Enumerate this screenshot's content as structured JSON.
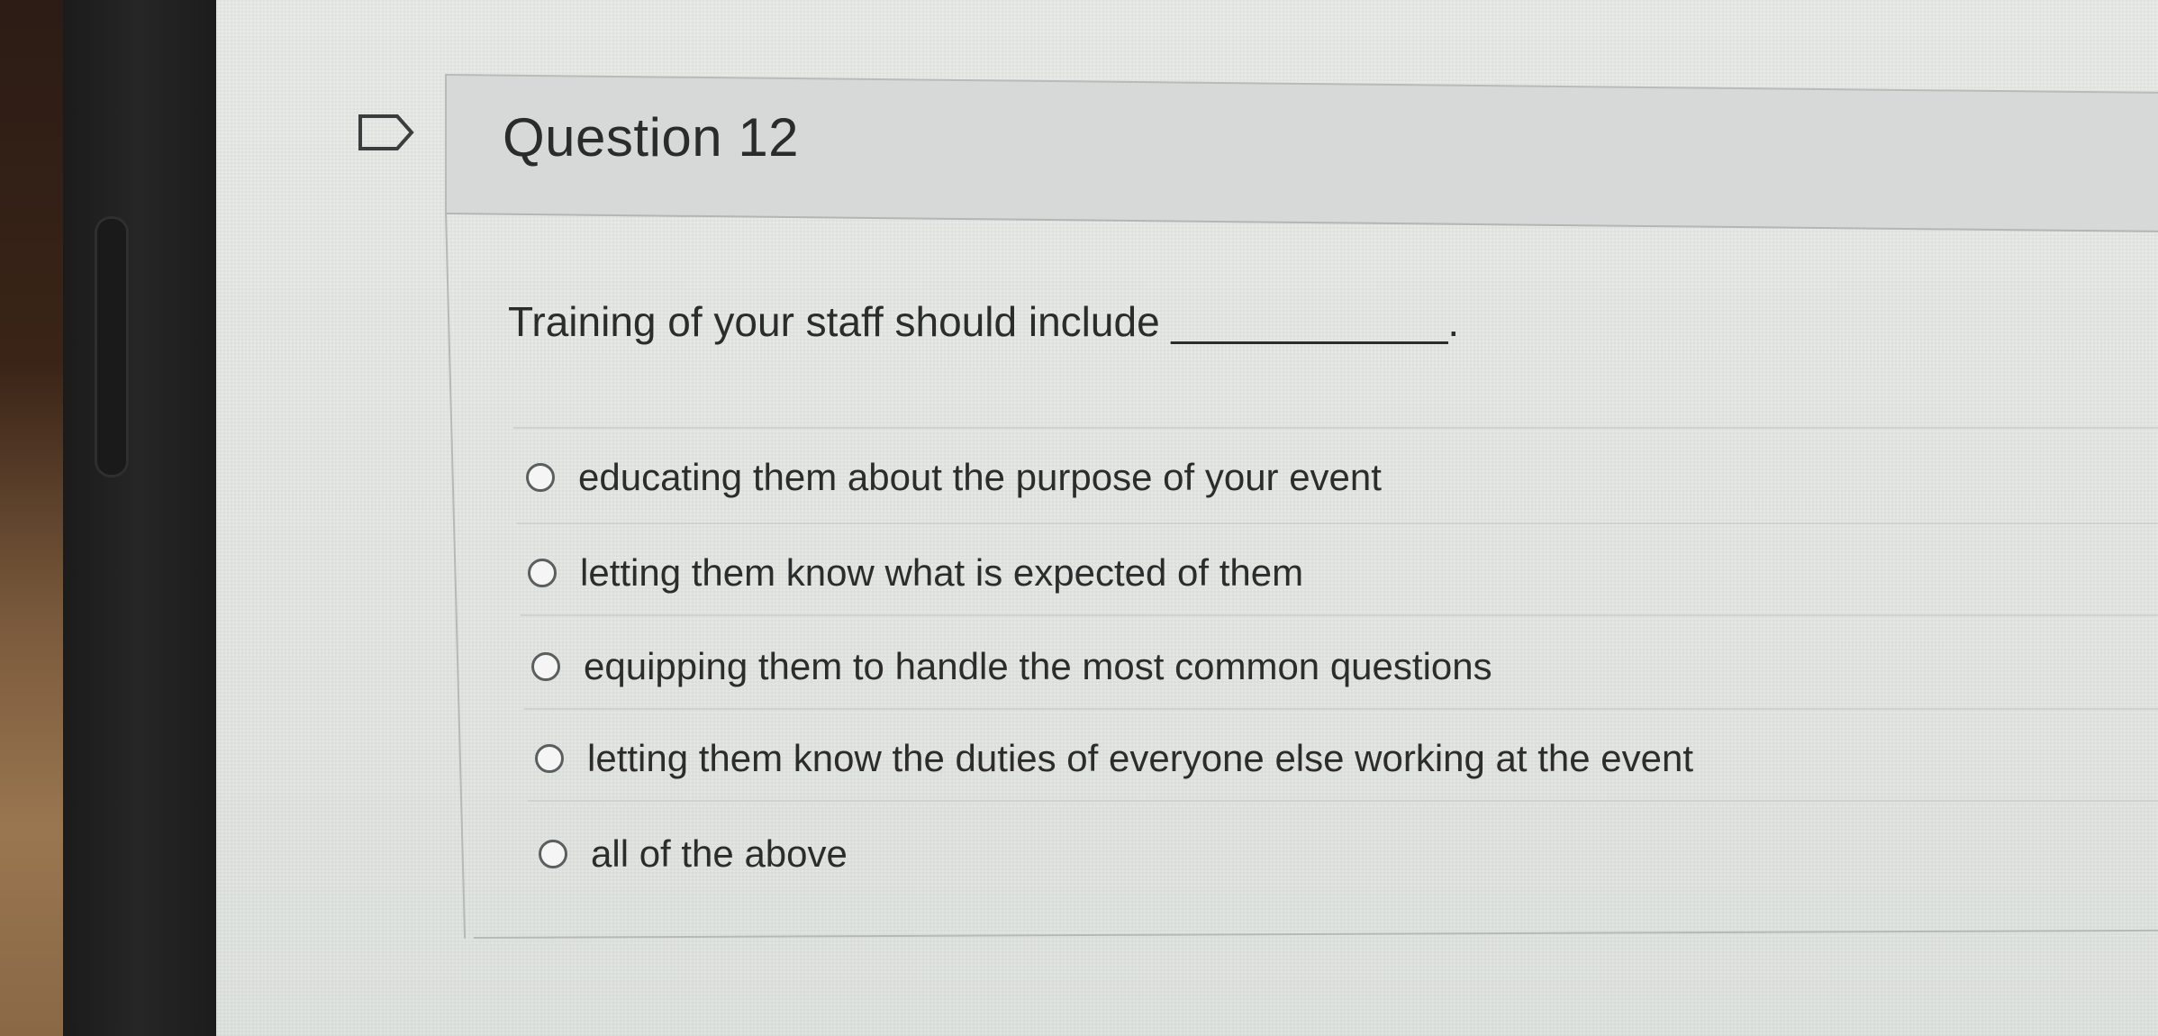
{
  "question": {
    "title": "Question 12",
    "prompt": "Training of your staff should include ____________.",
    "answers": [
      {
        "label": "educating them about the purpose of your event"
      },
      {
        "label": "letting them know what is expected of them"
      },
      {
        "label": "equipping them to handle the most common questions"
      },
      {
        "label": "letting them know the duties of everyone else working at the event"
      },
      {
        "label": "all of the above"
      }
    ]
  },
  "icons": {
    "flag": "flag-outline-icon",
    "radio": "radio-unselected-icon"
  },
  "colors": {
    "header_bg": "#d6d9d8",
    "text": "#2c2c2c"
  }
}
